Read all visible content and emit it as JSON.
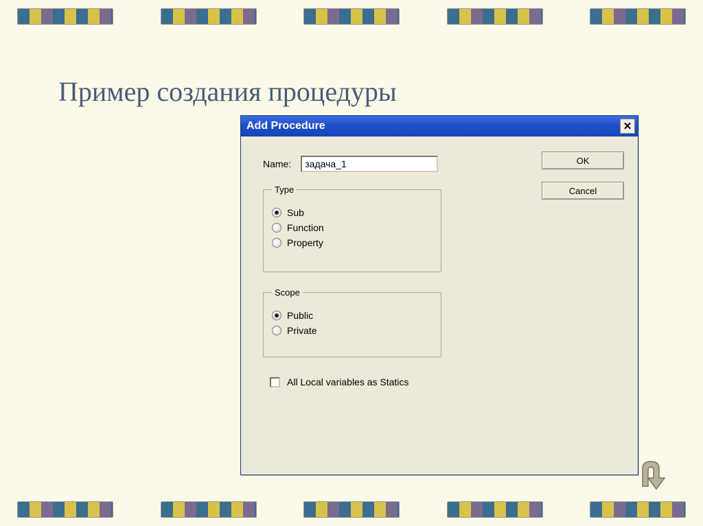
{
  "slide_title": "Пример создания процедуры",
  "dialog": {
    "title": "Add Procedure",
    "name_label": "Name:",
    "name_value": "задача_1",
    "buttons": {
      "ok": "OK",
      "cancel": "Cancel"
    },
    "type_group": {
      "legend": "Type",
      "options": [
        "Sub",
        "Function",
        "Property"
      ],
      "selected": "Sub"
    },
    "scope_group": {
      "legend": "Scope",
      "options": [
        "Public",
        "Private"
      ],
      "selected": "Public"
    },
    "statics_label": "All Local variables as Statics"
  }
}
